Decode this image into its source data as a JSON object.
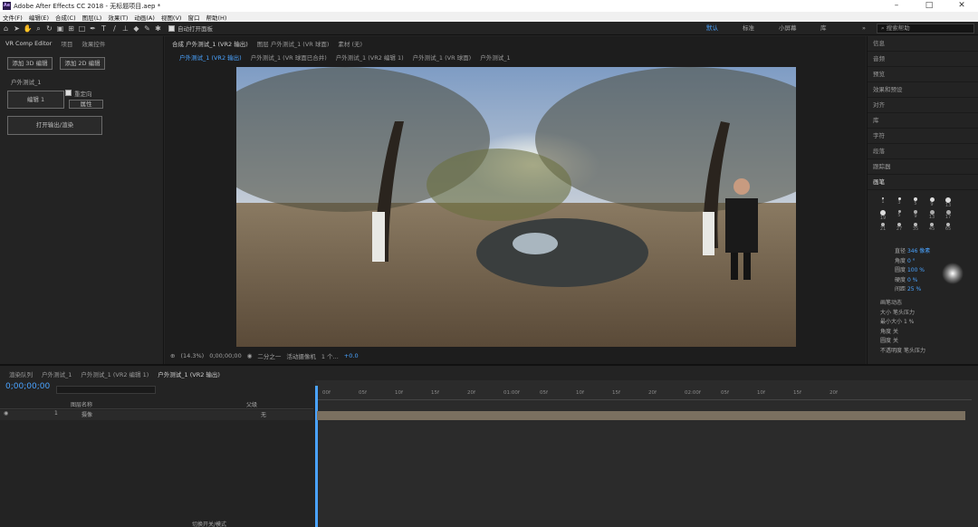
{
  "app": {
    "title": "Adobe After Effects CC 2018 - 无标题项目.aep *",
    "logo": "Ae"
  },
  "menu": [
    "文件(F)",
    "编辑(E)",
    "合成(C)",
    "图层(L)",
    "效果(T)",
    "动画(A)",
    "视图(V)",
    "窗口",
    "帮助(H)"
  ],
  "toolbar": {
    "auto_open": "自动打开面板",
    "workspaces": [
      "默认",
      "标准",
      "小屏幕",
      "库"
    ],
    "search_placeholder": "搜索帮助"
  },
  "left_panel": {
    "tabs": [
      "VR Comp Editor",
      "项目",
      "效果控件"
    ],
    "btn_add_3d": "添加 3D 编辑",
    "btn_add_2d": "添加 2D 编辑",
    "comp_name": "户外测试_1",
    "edit_label": "编辑 1",
    "reorient": "重定向",
    "props": "属性",
    "open_output": "打开输出/渲染"
  },
  "viewer": {
    "tabs": [
      "合成 户外测试_1 (VR2 输出)",
      "图层 户外测试_1 (VR 球面)",
      "素材 (无)"
    ],
    "flow": [
      "户外测试_1 (VR2 输出)",
      "户外测试_1 (VR 球面已合并)",
      "户外测试_1 (VR2 编辑 1)",
      "户外测试_1 (VR 球面)",
      "户外测试_1"
    ],
    "zoom": "(14.3%)",
    "time": "0;00;00;00",
    "res": "二分之一",
    "camera": "活动摄像机",
    "views": "1 个...",
    "exposure": "+0.0"
  },
  "right_panel": {
    "items": [
      "信息",
      "音频",
      "预览",
      "效果和预设",
      "对齐",
      "库",
      "字符",
      "段落",
      "跟踪器"
    ],
    "brush_title": "画笔",
    "diameter_label": "直径",
    "diameter": "346 像素",
    "angle_label": "角度",
    "angle": "0 °",
    "roundness_label": "圆度",
    "roundness": "100 %",
    "hardness_label": "硬度",
    "hardness": "0 %",
    "spacing_label": "间距",
    "spacing": "25 %",
    "dynamics": "画笔动态",
    "size_label": "大小",
    "size": "笔头压力",
    "min_size_label": "最小大小",
    "min_size": "1 %",
    "angle2_label": "角度",
    "angle2": "关",
    "round2_label": "圆度",
    "round2": "关",
    "opacity_label": "不透明度",
    "opacity": "笔头压力",
    "brush_sizes": [
      "1",
      "3",
      "5",
      "9",
      "13",
      "19",
      "5",
      "9",
      "13",
      "17",
      "21",
      "27",
      "35",
      "45",
      "65"
    ]
  },
  "timeline": {
    "tabs": [
      "渲染队列",
      "户外测试_1",
      "户外测试_1 (VR2 编辑 1)",
      "户外测试_1 (VR2 输出)"
    ],
    "timecode": "0;00;00;00",
    "col_name": "图层名称",
    "col_parent": "父级",
    "layer_num": "1",
    "layer_name": "摄像",
    "parent_val": "无",
    "ruler": [
      "00f",
      "05f",
      "10f",
      "15f",
      "20f",
      "01:00f",
      "05f",
      "10f",
      "15f",
      "20f",
      "02:00f",
      "05f",
      "10f",
      "15f",
      "20f"
    ],
    "footer": "切换开关/模式"
  }
}
